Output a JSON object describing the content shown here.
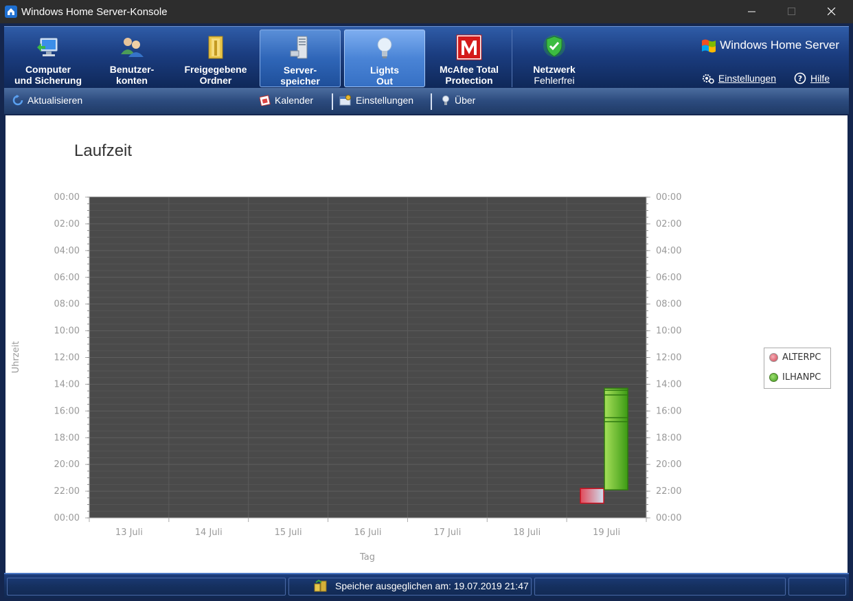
{
  "window": {
    "title": "Windows Home Server-Konsole"
  },
  "nav": {
    "tabs": [
      {
        "l1": "Computer",
        "l2": "und Sicherung"
      },
      {
        "l1": "Benutzer-",
        "l2": "konten"
      },
      {
        "l1": "Freigegebene",
        "l2": "Ordner"
      },
      {
        "l1": "Server-",
        "l2": "speicher"
      },
      {
        "l1": "Lights",
        "l2": "Out"
      },
      {
        "l1": "McAfee Total",
        "l2": "Protection"
      }
    ],
    "network": {
      "title": "Netzwerk",
      "status": "Fehlerfrei"
    },
    "brand": "Windows Home Server",
    "settings": "Einstellungen",
    "help": "Hilfe"
  },
  "toolbar": {
    "refresh": "Aktualisieren",
    "calendar": "Kalender",
    "settings": "Einstellungen",
    "about": "Über"
  },
  "page": {
    "title": "Laufzeit"
  },
  "chart_data": {
    "type": "bar",
    "title": "Laufzeit",
    "xlabel": "Tag",
    "ylabel": "Uhrzeit",
    "categories": [
      "13 Juli",
      "14 Juli",
      "15 Juli",
      "16 Juli",
      "17 Juli",
      "18 Juli",
      "19 Juli"
    ],
    "y_ticks": [
      "00:00",
      "02:00",
      "04:00",
      "06:00",
      "08:00",
      "10:00",
      "12:00",
      "14:00",
      "16:00",
      "18:00",
      "20:00",
      "22:00",
      "00:00"
    ],
    "ylim": [
      0,
      24
    ],
    "y_inverted": true,
    "grid": true,
    "legend": "right",
    "series": [
      {
        "name": "ALTERPC",
        "color": "#e05060",
        "ranges": [
          {
            "category": "19 Juli",
            "start": 21.8,
            "end": 22.9
          }
        ]
      },
      {
        "name": "ILHANPC",
        "color": "#5ab52a",
        "ranges": [
          {
            "category": "19 Juli",
            "start": 14.3,
            "end": 21.9
          }
        ]
      }
    ]
  },
  "status": {
    "message": "Speicher ausgeglichen am: 19.07.2019 21:47"
  }
}
